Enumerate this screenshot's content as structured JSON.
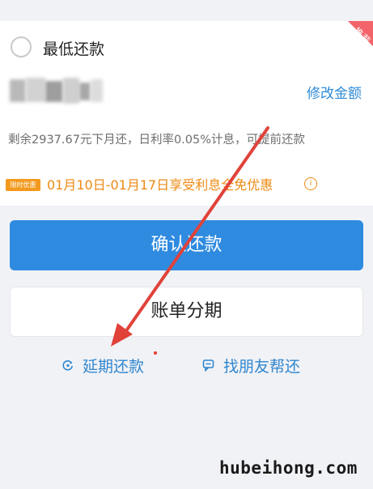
{
  "repayment_option": {
    "label": "最低还款",
    "badge": "推荐",
    "modify_link": "修改金额",
    "remaining_note": "剩余2937.67元下月还，日利率0.05%计息，可提前还款"
  },
  "promotion": {
    "badge": "限时优惠",
    "text": "01月10日-01月17日享受利息全免优惠",
    "info_icon": "①"
  },
  "buttons": {
    "confirm": "确认还款",
    "installment": "账单分期"
  },
  "links": {
    "extend": "延期还款",
    "friend_help": "找朋友帮还"
  },
  "watermark": "hubeihong.com",
  "colors": {
    "primary": "#2f8be0",
    "link": "#2f86cf",
    "promo": "#ee8a13",
    "badge": "#f26469",
    "arrow": "#e0423a"
  }
}
